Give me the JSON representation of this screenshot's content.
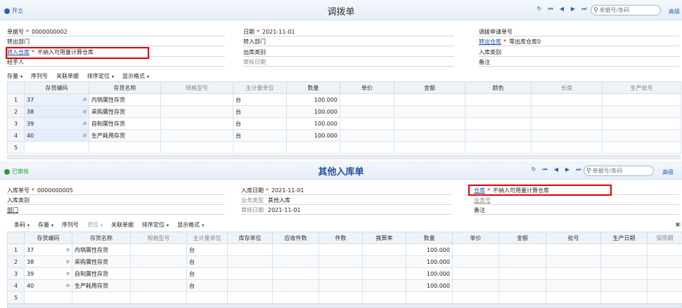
{
  "doc1": {
    "status": "开立",
    "title": "调拨单",
    "search_placeholder": "单据号/条码",
    "advanced": "高级",
    "fields": {
      "doc_no_label": "单据号",
      "doc_no": "0000000002",
      "date_label": "日期",
      "date": "2021-11-01",
      "transfer_req_label": "调拨申请单号",
      "out_dept_label": "转出部门",
      "in_dept_label": "转入部门",
      "out_wh_label": "转出仓库",
      "out_wh": "零出库仓库0",
      "in_wh_label": "转入仓库",
      "in_wh": "不纳入可用量计算仓库",
      "out_type_label": "出库类别",
      "in_type_label": "入库类别",
      "handler_label": "经手人",
      "audit_date_label": "审核日期",
      "remark_label": "备注"
    },
    "toolbar": [
      "存量",
      "序列号",
      "关联单据",
      "排序定位",
      "显示格式"
    ],
    "columns": [
      "存货编码",
      "存货名称",
      "规格型号",
      "主计量单位",
      "数量",
      "单价",
      "金额",
      "颜色",
      "长度",
      "生产批号"
    ],
    "rows": [
      {
        "no": "1",
        "code": "37",
        "name": "内销属性存货",
        "unit": "台",
        "qty": "100.000"
      },
      {
        "no": "2",
        "code": "38",
        "name": "采购属性存货",
        "unit": "台",
        "qty": "100.000"
      },
      {
        "no": "3",
        "code": "39",
        "name": "自制属性存货",
        "unit": "台",
        "qty": "100.000"
      },
      {
        "no": "4",
        "code": "40",
        "name": "生产耗用存货",
        "unit": "台",
        "qty": "100.000"
      },
      {
        "no": "5",
        "code": "",
        "name": "",
        "unit": "",
        "qty": ""
      }
    ]
  },
  "doc2": {
    "status": "已审核",
    "title": "其他入库单",
    "search_placeholder": "单据号/条码",
    "advanced": "高级",
    "fields": {
      "in_no_label": "入库单号",
      "in_no": "0000000005",
      "in_date_label": "入库日期",
      "in_date": "2021-11-01",
      "wh_label": "仓库",
      "wh": "不纳入可用量计算仓库",
      "in_type_label": "入库类别",
      "biz_type_label": "业务类型",
      "biz_type": "其他入库",
      "biz_no_label": "业务号",
      "dept_label": "部门",
      "audit_date_label": "审核日期",
      "audit_date": "2021-11-01",
      "remark_label": "备注"
    },
    "toolbar": [
      "条码",
      "存量",
      "序列号",
      "货位",
      "关联单据",
      "排序定位",
      "显示格式"
    ],
    "columns": [
      "存货编码",
      "存货名称",
      "规格型号",
      "主计量单位",
      "库存单位",
      "应收件数",
      "件数",
      "换算率",
      "数量",
      "单价",
      "金额",
      "批号",
      "生产日期",
      "保质期"
    ],
    "rows": [
      {
        "no": "1",
        "code": "37",
        "name": "内销属性存货",
        "unit": "台",
        "qty": "100.000"
      },
      {
        "no": "2",
        "code": "38",
        "name": "采购属性存货",
        "unit": "台",
        "qty": "100.000"
      },
      {
        "no": "3",
        "code": "39",
        "name": "自制属性存货",
        "unit": "台",
        "qty": "100.000"
      },
      {
        "no": "4",
        "code": "40",
        "name": "生产耗用存货",
        "unit": "台",
        "qty": "100.000"
      },
      {
        "no": "5",
        "code": "",
        "name": "",
        "unit": "",
        "qty": ""
      }
    ]
  },
  "colors": {
    "accent": "#1f4ea0",
    "required": "#d20000",
    "highlight_box": "#e00000",
    "audited": "#2f9a3a"
  },
  "icons": [
    "refresh-icon",
    "first-page-icon",
    "prev-page-icon",
    "next-page-icon",
    "last-page-icon",
    "search-icon",
    "attachment-icon"
  ]
}
